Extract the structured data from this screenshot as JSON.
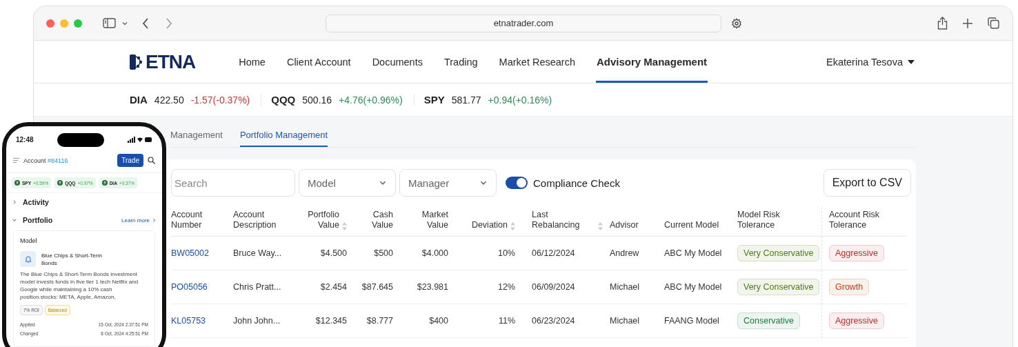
{
  "browser": {
    "url": "etnatrader.com"
  },
  "site": {
    "logo": "ETNA",
    "nav": [
      {
        "label": "Home",
        "selected": false
      },
      {
        "label": "Client Account",
        "selected": false
      },
      {
        "label": "Documents",
        "selected": false
      },
      {
        "label": "Trading",
        "selected": false
      },
      {
        "label": "Market Research",
        "selected": false
      },
      {
        "label": "Advisory Management",
        "selected": true
      }
    ],
    "user": "Ekaterina Tesova"
  },
  "ticker": [
    {
      "symbol": "DIA",
      "price": "422.50",
      "change": "-1.57(-0.37%)",
      "color": "#c93636"
    },
    {
      "symbol": "QQQ",
      "price": "500.16",
      "change": "+4.76(+0.96%)",
      "color": "#2e8b57"
    },
    {
      "symbol": "SPY",
      "price": "581.77",
      "change": "+0.94(+0.16%)",
      "color": "#2e8b57"
    }
  ],
  "subtabs": [
    {
      "label": "Management",
      "selected": false
    },
    {
      "label": "Portfolio Management",
      "selected": true
    }
  ],
  "filters": {
    "search_placeholder": "Search",
    "selects": [
      "Model",
      "Manager"
    ],
    "compliance": {
      "label": "Compliance Check",
      "on": true
    },
    "export": "Export to CSV"
  },
  "table": {
    "columns": [
      {
        "label": "Account Number",
        "sortable": false
      },
      {
        "label": "Account Description",
        "sortable": false
      },
      {
        "label": "Portfolio Value",
        "sortable": true
      },
      {
        "label": "Cash Value",
        "sortable": false
      },
      {
        "label": "Market Value",
        "sortable": false
      },
      {
        "label": "Deviation",
        "sortable": true
      },
      {
        "label": "Last Rebalancing",
        "sortable": true
      },
      {
        "label": "Advisor",
        "sortable": false
      },
      {
        "label": "Current Model",
        "sortable": false
      },
      {
        "label": "Model Risk Tolerance",
        "sortable": false
      },
      {
        "label": "Account Risk Tolerance",
        "sortable": false
      }
    ],
    "rows": [
      {
        "account": "BW05002",
        "description": "Bruce Way...",
        "portfolio": "$4.500",
        "cash": "$500",
        "market": "$4.000",
        "deviation": "10%",
        "rebalanced": "06/12/2024",
        "advisor": "Andrew",
        "model": "ABC My Model",
        "model_risk": {
          "label": "Very Conservative",
          "color": "#4d7c0f"
        },
        "account_risk": {
          "label": "Aggressive",
          "color": "#c62828"
        }
      },
      {
        "account": "PO05056",
        "description": "Chris Pratt...",
        "portfolio": "$2.454",
        "cash": "$87.645",
        "market": "$23.981",
        "deviation": "12%",
        "rebalanced": "06/09/2024",
        "advisor": "Michael",
        "model": "ABC My Model",
        "model_risk": {
          "label": "Very Conservative",
          "color": "#4d7c0f"
        },
        "account_risk": {
          "label": "Growth",
          "color": "#c2410c"
        }
      },
      {
        "account": "KL05753",
        "description": "John John...",
        "portfolio": "$12.345",
        "cash": "$8.777",
        "market": "$400",
        "deviation": "11%",
        "rebalanced": "06/23/2024",
        "advisor": "Michael",
        "model": "FAANG Model",
        "model_risk": {
          "label": "Conservative",
          "color": "#15803d"
        },
        "account_risk": {
          "label": "Aggressive",
          "color": "#c62828"
        }
      }
    ]
  },
  "phone": {
    "time": "12:48",
    "account_label": "Account",
    "account_number": "#84116",
    "trade": "Trade",
    "chips": [
      {
        "symbol": "SPY",
        "change": "+0.59%"
      },
      {
        "symbol": "QQQ",
        "change": "+0.97%"
      },
      {
        "symbol": "DIA",
        "change": "+0.37%"
      }
    ],
    "sections": [
      {
        "title": "Activity",
        "expanded": false
      },
      {
        "title": "Portfolio",
        "expanded": true,
        "link": "Learn more"
      }
    ],
    "model_card": {
      "heading": "Model",
      "name": "Blue Chips & Short-Term Bonds",
      "description": "The Blue Chips & Short-Term Bonds investment model invests funds in five tier 1 tech Netflix and Google while maintaining a 10% cash position.stocks: META, Apple, Amazon,",
      "tags": [
        {
          "label": "7% ROI",
          "kind": "neutral"
        },
        {
          "label": "Balanced",
          "kind": "warning"
        }
      ],
      "details": [
        {
          "label": "Applied",
          "value": "15 Oct, 2024 2:37:51 PM"
        },
        {
          "label": "Changed",
          "value": "8 Oct, 2024 4:25:51 PM"
        }
      ]
    }
  }
}
